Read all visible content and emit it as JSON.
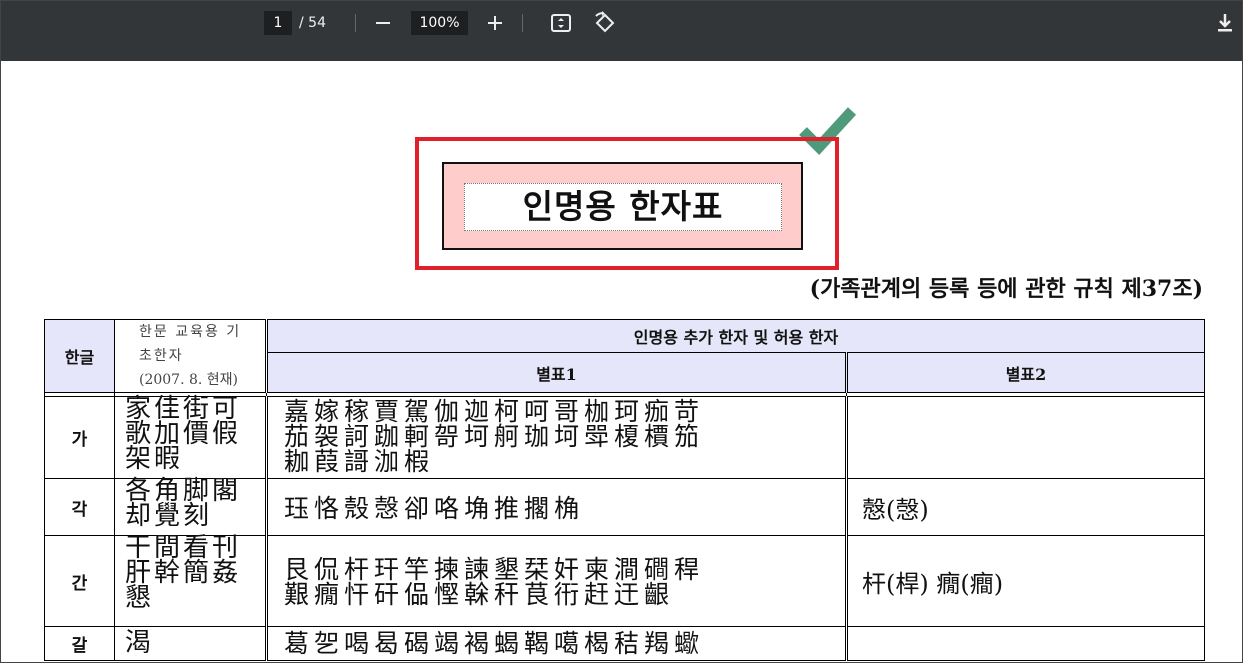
{
  "toolbar": {
    "page_current": "1",
    "page_total": "/ 54",
    "zoom_level": "100%",
    "zoom_out": "—",
    "zoom_in": "+"
  },
  "document": {
    "title": "인명용 한자표",
    "subtitle": "(가족관계의 등록 등에 관한 규칙 제37조)",
    "table": {
      "headers": {
        "hangul": "한글",
        "edu_line1": "한문 교육용 기",
        "edu_line2": "초한자",
        "edu_line3": "(2007. 8. 현재)",
        "added": "인명용 추가 한자 및 허용 한자",
        "table1": "별표1",
        "table2": "별표2"
      },
      "rows": [
        {
          "hangul": "가",
          "edu": [
            "家佳街可",
            "歌加價假",
            "架暇"
          ],
          "table1": [
            "嘉嫁稼賈駕伽迦柯呵哥枷珂痂苛",
            "茄袈訶跏軻哿坷舸珈坷斝榎檟笳",
            "耞葭謌泇椵"
          ],
          "table2": ""
        },
        {
          "hangul": "각",
          "edu": [
            "各角脚閣",
            "却覺刻"
          ],
          "table1": [
            "珏恪殼愨卻咯埆推擱桷"
          ],
          "table2": "慤(愨)"
        },
        {
          "hangul": "간",
          "edu": [
            "干間看刊",
            "肝幹簡姦",
            "懇"
          ],
          "table1": [
            "艮侃杆玕竿揀諫墾栞奸柬澗磵稈",
            "艱癇忓矸偘慳榦秆茛衎赶迀齦"
          ],
          "table2": "杆(桿)  癇(癎)"
        },
        {
          "hangul": "갈",
          "edu": [
            "渴"
          ],
          "table1": [
            "葛乫喝曷碣竭褐蝎鞨噶楬秸羯蠍"
          ],
          "table2": ""
        }
      ]
    }
  },
  "colors": {
    "toolbar_bg": "#333638",
    "highlight_border": "#e0202a",
    "title_bg": "#ffcccc",
    "check": "#4e9a7a",
    "header_bg": "#e6e6fa"
  }
}
